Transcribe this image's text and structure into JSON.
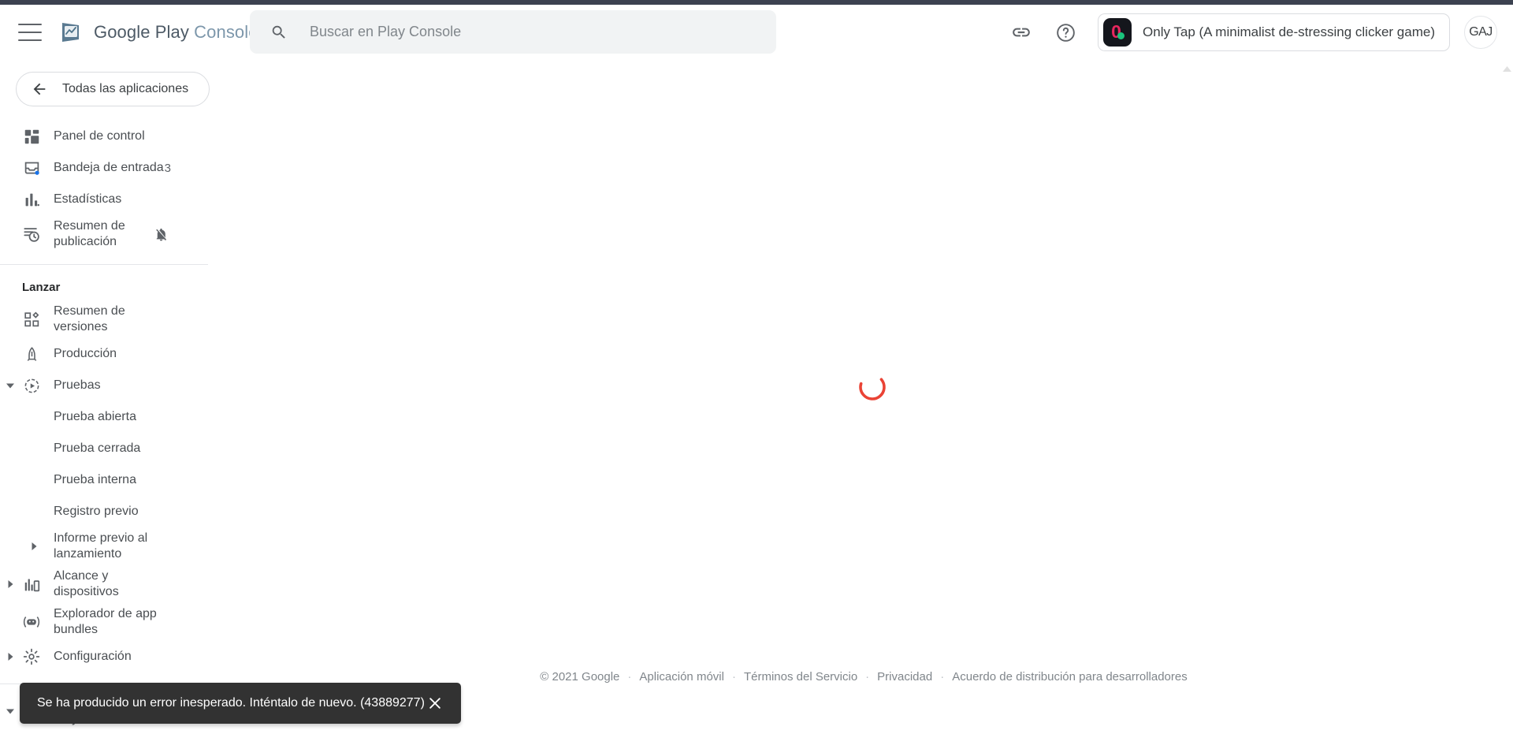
{
  "header": {
    "menu_icon": "hamburger-menu-icon",
    "brand_google_play": "Google Play",
    "brand_console": "Console",
    "logo_icon": "play-console-logo-icon",
    "search": {
      "placeholder": "Buscar en Play Console",
      "value": "",
      "icon": "search-icon"
    },
    "link_icon": "link-icon",
    "help_icon": "help-circle-icon",
    "app_chip": {
      "label": "Only Tap (A minimalist de-stressing clicker game)",
      "icon_glyph": "0",
      "icon_name": "app-icon-only-tap"
    },
    "avatar_initials": "GAJ"
  },
  "sidebar": {
    "back_button": {
      "label": "Todas las aplicaciones",
      "icon": "arrow-left-icon"
    },
    "primary_items": [
      {
        "label": "Panel de control",
        "icon": "dashboard-icon",
        "trailing": "",
        "expander": ""
      },
      {
        "label": "Bandeja de entrada",
        "icon": "inbox-icon",
        "trailing": "3",
        "expander": ""
      },
      {
        "label": "Estadísticas",
        "icon": "bar-chart-icon",
        "trailing": "",
        "expander": ""
      },
      {
        "label": "Resumen de publicación",
        "icon": "publishing-overview-icon",
        "trailing": "notifications-off-icon",
        "expander": ""
      }
    ],
    "group_launch_title": "Lanzar",
    "launch_items": [
      {
        "label": "Resumen de versiones",
        "icon": "releases-overview-icon",
        "expander": "",
        "sub": false
      },
      {
        "label": "Producción",
        "icon": "production-rocket-icon",
        "expander": "",
        "sub": false
      },
      {
        "label": "Pruebas",
        "icon": "testing-play-icon",
        "expander": "down",
        "sub": false
      },
      {
        "label": "Prueba abierta",
        "icon": "",
        "expander": "",
        "sub": true
      },
      {
        "label": "Prueba cerrada",
        "icon": "",
        "expander": "",
        "sub": true
      },
      {
        "label": "Prueba interna",
        "icon": "",
        "expander": "",
        "sub": true
      },
      {
        "label": "Registro previo",
        "icon": "",
        "expander": "",
        "sub": true
      },
      {
        "label": "Informe previo al lanzamiento",
        "icon": "",
        "expander": "right",
        "sub": true
      },
      {
        "label": "Alcance y dispositivos",
        "icon": "reach-devices-icon",
        "expander": "right",
        "sub": false
      },
      {
        "label": "Explorador de app bundles",
        "icon": "app-bundle-explorer-icon",
        "expander": "",
        "sub": false
      },
      {
        "label": "Configuración",
        "icon": "gear-icon",
        "expander": "right",
        "sub": false
      }
    ],
    "bottom_items": [
      {
        "label": "Presencia en Google Play",
        "icon": "store-presence-icon",
        "expander": "down",
        "sub": false
      }
    ]
  },
  "main": {
    "loading_spinner": "loading-spinner",
    "spinner_color": "#ea4335"
  },
  "footer": {
    "copyright": "© 2021 Google",
    "links": [
      "Aplicación móvil",
      "Términos del Servicio",
      "Privacidad",
      "Acuerdo de distribución para desarrolladores"
    ],
    "separator": "·"
  },
  "toast": {
    "message": "Se ha producido un error inesperado. Inténtalo de nuevo. (43889277)",
    "close_icon": "close-icon"
  },
  "scrollbar": {
    "up_arrow_icon": "chevron-up-icon"
  }
}
